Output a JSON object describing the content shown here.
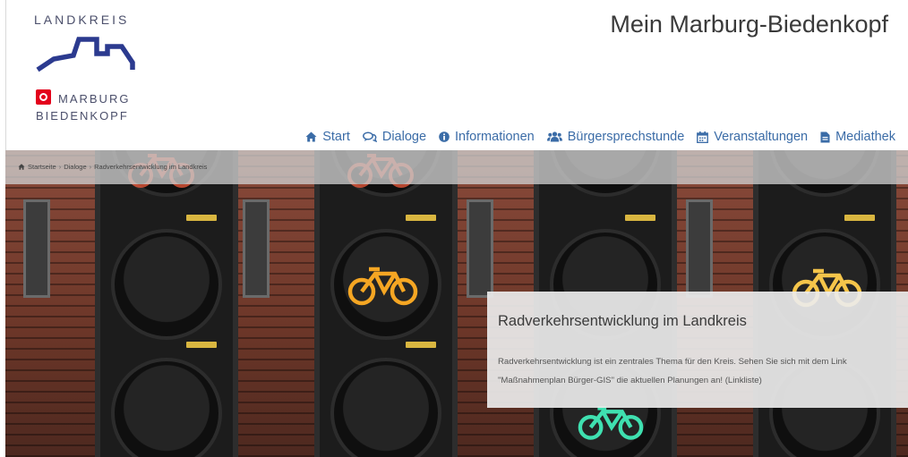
{
  "logo": {
    "line1": "LANDKREIS",
    "line2": "MARBURG",
    "line3": "BIEDENKOPF",
    "brand_blue": "#2b3a8f",
    "brand_red": "#e3001b"
  },
  "header": {
    "title": "Mein Marburg-Biedenkopf"
  },
  "nav": {
    "items": [
      {
        "label": "Start",
        "icon": "home-icon"
      },
      {
        "label": "Dialoge",
        "icon": "comments-icon"
      },
      {
        "label": "Informationen",
        "icon": "info-circle-icon"
      },
      {
        "label": "Bürgersprechstunde",
        "icon": "users-icon"
      },
      {
        "label": "Veranstaltungen",
        "icon": "calendar-icon"
      },
      {
        "label": "Mediathek",
        "icon": "file-icon"
      }
    ],
    "color": "#3b6ca7"
  },
  "breadcrumb": {
    "icon": "home-icon",
    "items": [
      "Startseite",
      "Dialoge",
      "Radverkehrsentwicklung im Landkreis"
    ],
    "separator": "›"
  },
  "hero": {
    "image": "traffic-lights-bicycle-signals",
    "bike_colors": [
      "#f05a3c",
      "#f5a623",
      "#3fe0b0",
      "#f5c54a"
    ]
  },
  "info_box": {
    "title": "Radverkehrsentwicklung im Landkreis",
    "text": "Radverkehrsentwicklung ist ein zentrales Thema für den Kreis. Sehen Sie sich mit dem Link \"Maßnahmenplan Bürger-GIS\" die aktuellen Planungen an! (Linkliste)"
  }
}
